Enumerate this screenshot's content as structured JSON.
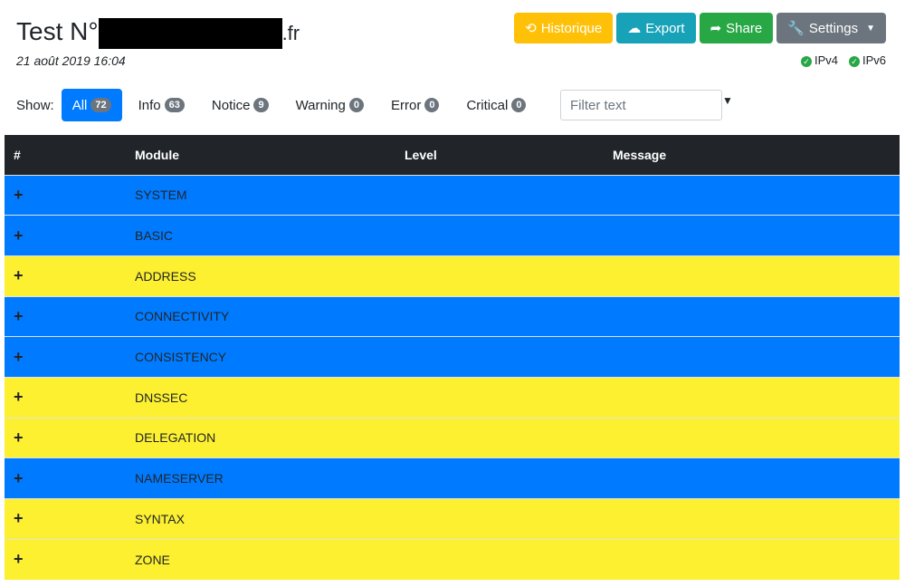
{
  "header": {
    "title_prefix": "Test N°",
    "title_suffix": ".fr",
    "date": "21 août 2019 16:04"
  },
  "buttons": [
    {
      "label": "Historique",
      "icon": "history-icon",
      "color": "#ffc107"
    },
    {
      "label": "Export",
      "icon": "cloud-download-icon",
      "color": "#17a2b8"
    },
    {
      "label": "Share",
      "icon": "share-icon",
      "color": "#28a745"
    },
    {
      "label": "Settings",
      "icon": "wrench-icon",
      "color": "#6c757d"
    }
  ],
  "ip": [
    "IPv4",
    "IPv6"
  ],
  "filters": {
    "show_label": "Show:",
    "items": [
      {
        "label": "All",
        "count": "72"
      },
      {
        "label": "Info",
        "count": "63"
      },
      {
        "label": "Notice",
        "count": "9"
      },
      {
        "label": "Warning",
        "count": "0"
      },
      {
        "label": "Error",
        "count": "0"
      },
      {
        "label": "Critical",
        "count": "0"
      }
    ],
    "placeholder": "Filter text"
  },
  "table": {
    "headers": [
      "#",
      "Module",
      "Level",
      "Message"
    ],
    "rows": [
      {
        "module": "SYSTEM",
        "color": "blue"
      },
      {
        "module": "BASIC",
        "color": "blue"
      },
      {
        "module": "ADDRESS",
        "color": "yellow"
      },
      {
        "module": "CONNECTIVITY",
        "color": "blue"
      },
      {
        "module": "CONSISTENCY",
        "color": "blue"
      },
      {
        "module": "DNSSEC",
        "color": "yellow"
      },
      {
        "module": "DELEGATION",
        "color": "yellow"
      },
      {
        "module": "NAMESERVER",
        "color": "blue"
      },
      {
        "module": "SYNTAX",
        "color": "yellow"
      },
      {
        "module": "ZONE",
        "color": "yellow"
      }
    ],
    "expand_symbol": "+"
  }
}
